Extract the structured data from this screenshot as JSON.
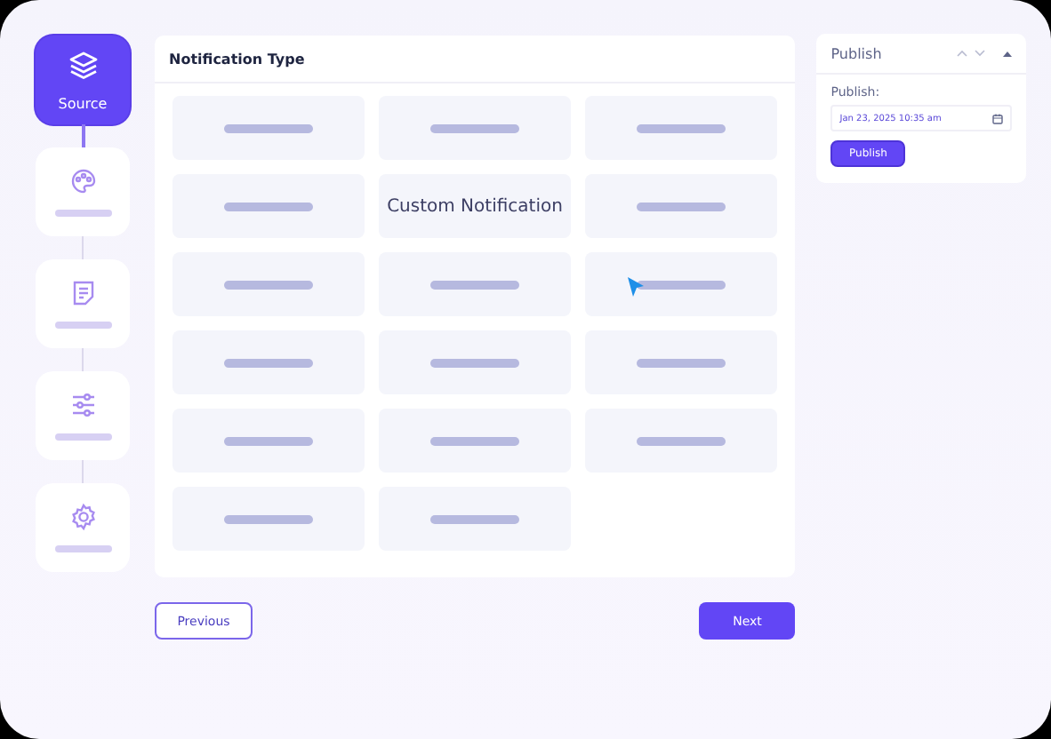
{
  "steps": [
    {
      "kind": "layers",
      "label": "Source",
      "selected": true
    },
    {
      "kind": "palette",
      "selected": false
    },
    {
      "kind": "note",
      "selected": false
    },
    {
      "kind": "sliders",
      "selected": false
    },
    {
      "kind": "gear",
      "selected": false
    }
  ],
  "panel": {
    "title": "Notification Type",
    "cards": [
      {
        "kind": "placeholder",
        "hovered": false
      },
      {
        "kind": "placeholder",
        "hovered": false
      },
      {
        "kind": "placeholder",
        "hovered": false
      },
      {
        "kind": "placeholder",
        "hovered": false
      },
      {
        "kind": "text",
        "label": "Custom Notification",
        "hovered": false
      },
      {
        "kind": "placeholder",
        "hovered": false
      },
      {
        "kind": "placeholder",
        "hovered": false
      },
      {
        "kind": "placeholder",
        "hovered": false
      },
      {
        "kind": "placeholder",
        "hovered": true
      },
      {
        "kind": "placeholder",
        "hovered": false
      },
      {
        "kind": "placeholder",
        "hovered": false
      },
      {
        "kind": "placeholder",
        "hovered": false
      },
      {
        "kind": "placeholder",
        "hovered": false
      },
      {
        "kind": "placeholder",
        "hovered": false
      },
      {
        "kind": "placeholder",
        "hovered": false
      },
      {
        "kind": "placeholder",
        "hovered": false
      },
      {
        "kind": "placeholder",
        "hovered": false
      }
    ]
  },
  "buttons": {
    "previous": "Previous",
    "next": "Next"
  },
  "publish": {
    "title": "Publish",
    "field_label": "Publish:",
    "date": "Jan 23, 2025 10:35 am",
    "button": "Publish"
  }
}
